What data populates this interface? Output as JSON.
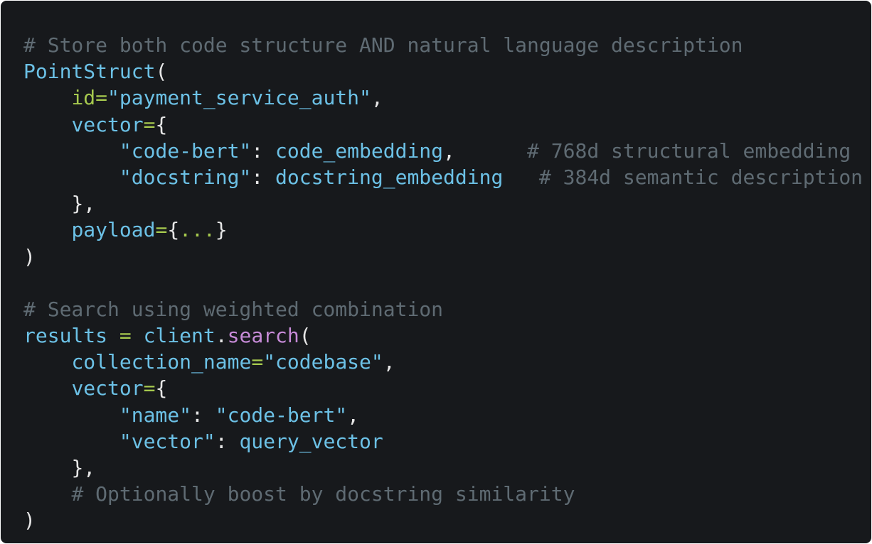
{
  "colors": {
    "background": "#17191c",
    "comment": "#5f6b73",
    "identifier": "#6cc1e6",
    "string": "#6cc1e6",
    "param": "#a6c94e",
    "operator": "#a6c94e",
    "punctuation": "#e6e6e6",
    "method": "#c78bd8"
  },
  "code": {
    "lines": [
      [
        {
          "t": "# Store both code structure AND natural language description",
          "k": "comment"
        }
      ],
      [
        {
          "t": "PointStruct",
          "k": "ident"
        },
        {
          "t": "(",
          "k": "punct"
        }
      ],
      [
        {
          "t": "    ",
          "k": "plain"
        },
        {
          "t": "id",
          "k": "param"
        },
        {
          "t": "=",
          "k": "op"
        },
        {
          "t": "\"payment_service_auth\"",
          "k": "string"
        },
        {
          "t": ",",
          "k": "punct"
        }
      ],
      [
        {
          "t": "    ",
          "k": "plain"
        },
        {
          "t": "vector",
          "k": "kwarg"
        },
        {
          "t": "=",
          "k": "op"
        },
        {
          "t": "{",
          "k": "punct"
        }
      ],
      [
        {
          "t": "        ",
          "k": "plain"
        },
        {
          "t": "\"code-bert\"",
          "k": "string"
        },
        {
          "t": ": ",
          "k": "punct"
        },
        {
          "t": "code_embedding",
          "k": "ident"
        },
        {
          "t": ",      ",
          "k": "punct"
        },
        {
          "t": "# 768d structural embedding",
          "k": "comment"
        }
      ],
      [
        {
          "t": "        ",
          "k": "plain"
        },
        {
          "t": "\"docstring\"",
          "k": "string"
        },
        {
          "t": ": ",
          "k": "punct"
        },
        {
          "t": "docstring_embedding",
          "k": "ident"
        },
        {
          "t": "   ",
          "k": "plain"
        },
        {
          "t": "# 384d semantic description",
          "k": "comment"
        }
      ],
      [
        {
          "t": "    ",
          "k": "plain"
        },
        {
          "t": "},",
          "k": "punct"
        }
      ],
      [
        {
          "t": "    ",
          "k": "plain"
        },
        {
          "t": "payload",
          "k": "kwarg"
        },
        {
          "t": "=",
          "k": "op"
        },
        {
          "t": "{",
          "k": "punct"
        },
        {
          "t": "...",
          "k": "op"
        },
        {
          "t": "}",
          "k": "punct"
        }
      ],
      [
        {
          "t": ")",
          "k": "punct"
        }
      ],
      [
        {
          "t": "",
          "k": "plain"
        }
      ],
      [
        {
          "t": "# Search using weighted combination",
          "k": "comment"
        }
      ],
      [
        {
          "t": "results",
          "k": "ident"
        },
        {
          "t": " = ",
          "k": "op"
        },
        {
          "t": "client",
          "k": "ident"
        },
        {
          "t": ".",
          "k": "punct"
        },
        {
          "t": "search",
          "k": "method"
        },
        {
          "t": "(",
          "k": "punct"
        }
      ],
      [
        {
          "t": "    ",
          "k": "plain"
        },
        {
          "t": "collection_name",
          "k": "kwarg"
        },
        {
          "t": "=",
          "k": "op"
        },
        {
          "t": "\"codebase\"",
          "k": "string"
        },
        {
          "t": ",",
          "k": "punct"
        }
      ],
      [
        {
          "t": "    ",
          "k": "plain"
        },
        {
          "t": "vector",
          "k": "kwarg"
        },
        {
          "t": "=",
          "k": "op"
        },
        {
          "t": "{",
          "k": "punct"
        }
      ],
      [
        {
          "t": "        ",
          "k": "plain"
        },
        {
          "t": "\"name\"",
          "k": "string"
        },
        {
          "t": ": ",
          "k": "punct"
        },
        {
          "t": "\"code-bert\"",
          "k": "string"
        },
        {
          "t": ",",
          "k": "punct"
        }
      ],
      [
        {
          "t": "        ",
          "k": "plain"
        },
        {
          "t": "\"vector\"",
          "k": "string"
        },
        {
          "t": ": ",
          "k": "punct"
        },
        {
          "t": "query_vector",
          "k": "ident"
        }
      ],
      [
        {
          "t": "    ",
          "k": "plain"
        },
        {
          "t": "},",
          "k": "punct"
        }
      ],
      [
        {
          "t": "    ",
          "k": "plain"
        },
        {
          "t": "# Optionally boost by docstring similarity",
          "k": "comment"
        }
      ],
      [
        {
          "t": ")",
          "k": "punct"
        }
      ]
    ]
  }
}
